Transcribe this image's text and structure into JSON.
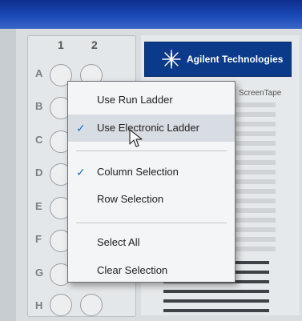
{
  "plate": {
    "columns": [
      "1",
      "2"
    ],
    "rows": [
      "A",
      "B",
      "C",
      "D",
      "E",
      "F",
      "G",
      "H"
    ]
  },
  "panel": {
    "logo_text": "Agilent Technologies",
    "tape_label": "ScreenTape"
  },
  "context_menu": {
    "items": [
      {
        "label": "Use Run Ladder",
        "checked": false
      },
      {
        "label": "Use Electronic Ladder",
        "checked": true,
        "hovered": true
      },
      {
        "label": "Column Selection",
        "checked": true
      },
      {
        "label": "Row Selection",
        "checked": false
      },
      {
        "label": "Select All",
        "checked": false
      },
      {
        "label": "Clear Selection",
        "checked": false
      }
    ],
    "check_glyph": "✓"
  },
  "colors": {
    "brand_blue": "#0b3a8a",
    "check_blue": "#1f6fd0",
    "menu_hover": "#d8dde3"
  }
}
